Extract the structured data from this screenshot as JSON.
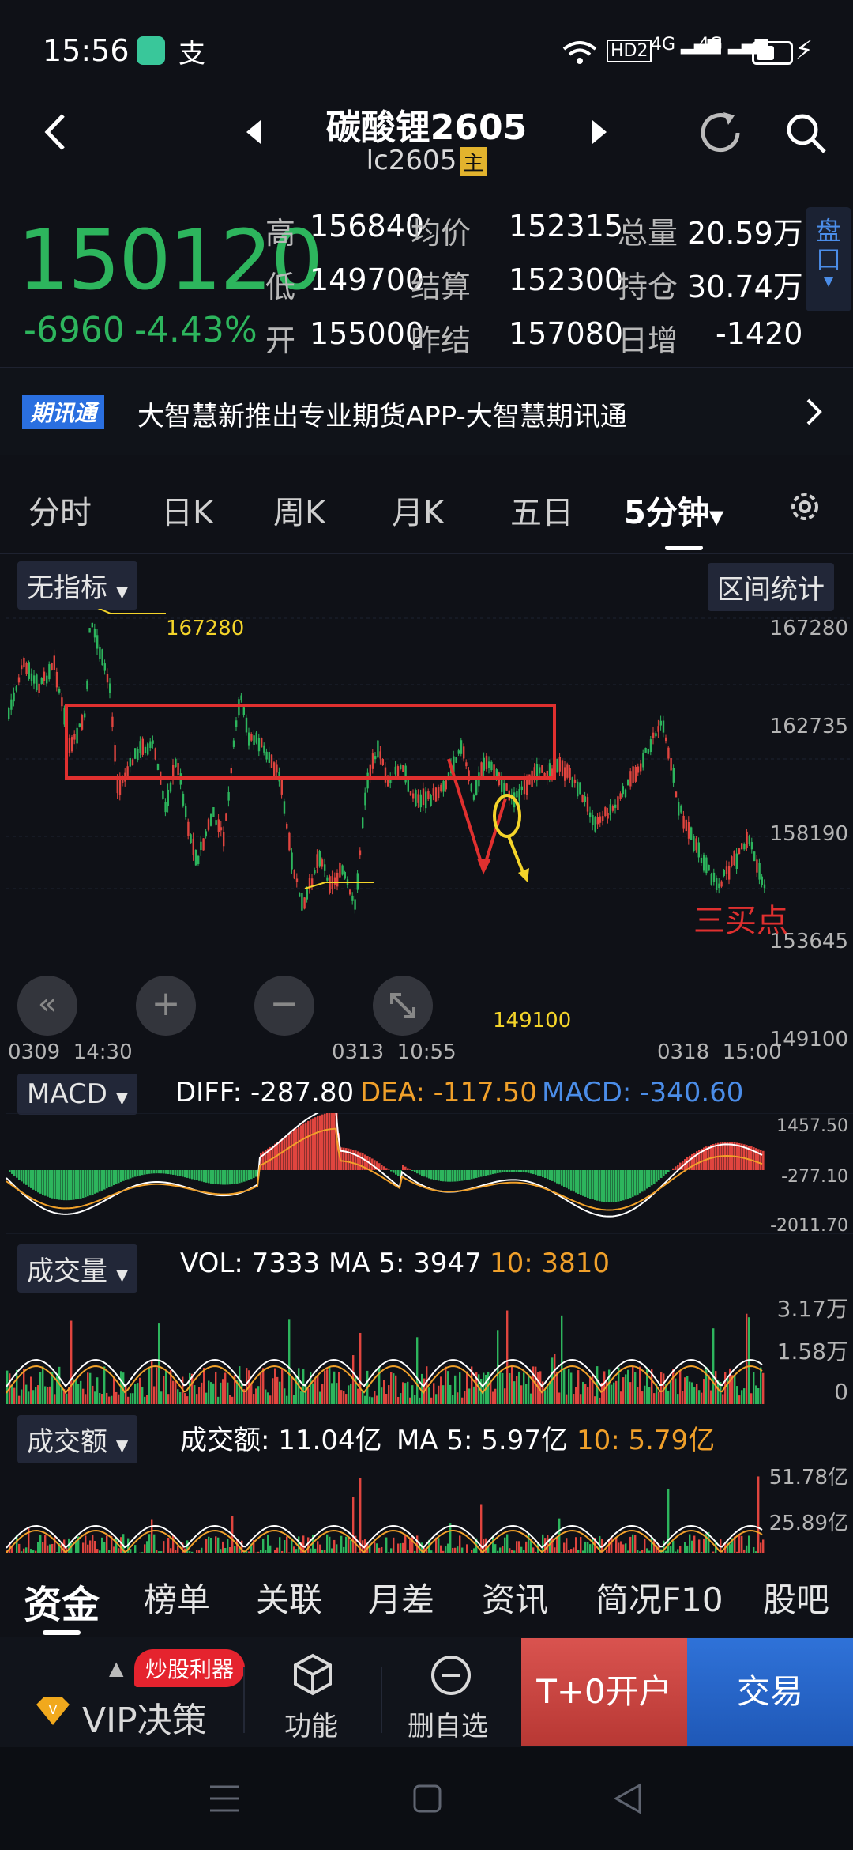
{
  "status": {
    "time": "15:56",
    "hd": "HD2",
    "net1": "4G",
    "net2": "4G"
  },
  "nav": {
    "title": "碳酸锂2605",
    "code": "lc2605",
    "main_badge": "主"
  },
  "quote": {
    "price": "150120",
    "change": "-6960",
    "change_pct": "-4.43%",
    "high_label": "高",
    "high": "156840",
    "low_label": "低",
    "low": "149700",
    "open_label": "开",
    "open": "155000",
    "avg_label": "均价",
    "avg": "152315",
    "settle_label": "结算",
    "settle": "152300",
    "prev_settle_label": "昨结",
    "prev_settle": "157080",
    "volume_label": "总量",
    "volume": "20.59万",
    "position_label": "持仓",
    "position": "30.74万",
    "daily_inc_label": "日增",
    "daily_inc": "-1420",
    "pankou": "盘口"
  },
  "banner": {
    "badge": "期讯通",
    "text": "大智慧新推出专业期货APP-大智慧期讯通"
  },
  "tabs": [
    "分时",
    "日K",
    "周K",
    "月K",
    "五日",
    "5分钟"
  ],
  "indicator": {
    "selector": "无指标",
    "range_stats": "区间统计"
  },
  "kline": {
    "axis": [
      "167280",
      "162735",
      "158190",
      "153645",
      "149100"
    ],
    "high_mark": "167280",
    "low_mark": "149100",
    "time_labels": [
      "0309  14:30",
      "0313  10:55",
      "0318  15:00"
    ],
    "annotation": "三买点"
  },
  "macd": {
    "selector": "MACD",
    "diff": "DIFF: -287.80",
    "dea": "DEA: -117.50",
    "macd": "MACD: -340.60",
    "axis": [
      "1457.50",
      "-277.10",
      "-2011.70"
    ]
  },
  "vol": {
    "selector": "成交量",
    "vol": "VOL: 7333",
    "ma5": "MA 5: 3947",
    "ma10": "10: 3810",
    "axis": [
      "3.17万",
      "1.58万",
      "0"
    ]
  },
  "amount": {
    "selector": "成交额",
    "amt": "成交额: 11.04亿",
    "ma5": "MA 5: 5.97亿",
    "ma10": "10: 5.79亿",
    "axis": [
      "51.78亿",
      "25.89亿"
    ]
  },
  "bottom_tabs": [
    "资金",
    "榜单",
    "关联",
    "月差",
    "资讯",
    "简况F10",
    "股吧"
  ],
  "bottom_bar": {
    "promo": "炒股利器",
    "vip": "VIP决策",
    "func": "功能",
    "del": "删自选",
    "open": "T+0开户",
    "trade": "交易"
  },
  "colors": {
    "up": "#e0453f",
    "down": "#2db55d",
    "orange": "#f0a02a",
    "blue": "#4b8de8",
    "yellow": "#f4d42a"
  }
}
